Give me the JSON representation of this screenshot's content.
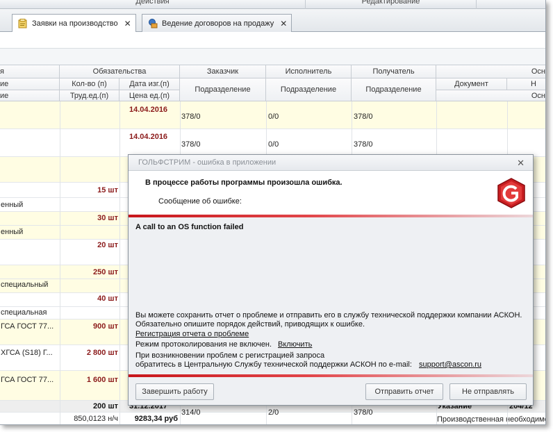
{
  "ribbon": {
    "group1": "Действия",
    "group2": "Редактирование"
  },
  "tabs": [
    {
      "label": "Заявки на производство",
      "close": "✕"
    },
    {
      "label": "Ведение договоров на продажу",
      "close": "✕"
    }
  ],
  "grid": {
    "header_top": {
      "c0": "я",
      "obligations": "Обязательства",
      "customer": "Заказчик",
      "executor": "Исполнитель",
      "receiver": "Получатель",
      "basis": "Осн"
    },
    "header_mid": {
      "c0": "ие",
      "qty": "Кол-во (п)",
      "date": "Дата изг.(п)",
      "customer_div": "Подразделение",
      "executor_div": "Подразделение",
      "receiver_div": "Подразделение",
      "doc": "Документ",
      "n": "Н"
    },
    "header_bot": {
      "c0": "ие",
      "labor": "Труд.ед.(п)",
      "price": "Цена ед.(п)",
      "basis2": "Осн"
    },
    "rows": [
      {
        "c0": "",
        "qty": "",
        "date": "14.04.2016",
        "cust": "378/0",
        "exec": "0/0",
        "recv": "378/0"
      },
      {
        "c0": "",
        "qty": "",
        "date": "14.04.2016",
        "cust": "378/0",
        "exec": "0/0",
        "recv": "378/0"
      },
      {
        "c0": "",
        "qty": "15 шт"
      },
      {
        "c0": "енный",
        "qty": ""
      },
      {
        "c0": "",
        "qty": "30 шт"
      },
      {
        "c0": "енный",
        "qty": ""
      },
      {
        "c0": "",
        "qty": "20 шт"
      },
      {
        "c0": "",
        "qty": "250 шт"
      },
      {
        "c0": "специальный",
        "qty": ""
      },
      {
        "c0": "",
        "qty": "40 шт"
      },
      {
        "c0": "специальная",
        "qty": ""
      },
      {
        "c0": "ГСА ГОСТ 77...",
        "qty": "900 шт"
      },
      {
        "c0": "ХГСА (S18) Г...",
        "qty": "2 800 шт"
      },
      {
        "c0": "ГСА ГОСТ 77...",
        "qty": "1 600 шт"
      }
    ],
    "total": {
      "qty": "200 шт",
      "date": "31.12.2017",
      "right1": "Указание",
      "right2": "204/12"
    },
    "total2": {
      "labor": "850,0123 н/ч",
      "price": "9283,34 руб",
      "cust": "314/0",
      "exec": "2/0",
      "recv": "378/0",
      "basis": "Производственная необходимо"
    }
  },
  "dialog": {
    "title": "ГОЛЬФСТРИМ - ошибка в приложении",
    "close": "✕",
    "headline": "В процессе работы программы произошла ошибка.",
    "message_label": "Сообщение об ошибке:",
    "error_text": "A call to an OS function failed",
    "info_line1": "Вы можете сохранить отчет о проблеме и отправить его в службу технической поддержки компании АСКОН.",
    "info_line2": "Обязательно опишите порядок действий, приводящих к ошибке.",
    "report_link": "Регистрация отчета о проблеме",
    "logging_text": "Режим протоколирования не включен.",
    "logging_link": "Включить",
    "contact_line1": "При возникновении проблем с регистрацией запроса",
    "contact_line2": "обратитесь в Центральную Службу технической поддержки АСКОН по e-mail:",
    "email": "support@ascon.ru",
    "btn_finish": "Завершить работу",
    "btn_send": "Отправить отчет",
    "btn_dont_send": "Не отправлять",
    "logo_letter": "G"
  },
  "colors": {
    "accent_red": "#c8161b",
    "row_yellow": "#fffde3",
    "date_red": "#8b1a1a",
    "link_blue": "#0b3fb7"
  }
}
